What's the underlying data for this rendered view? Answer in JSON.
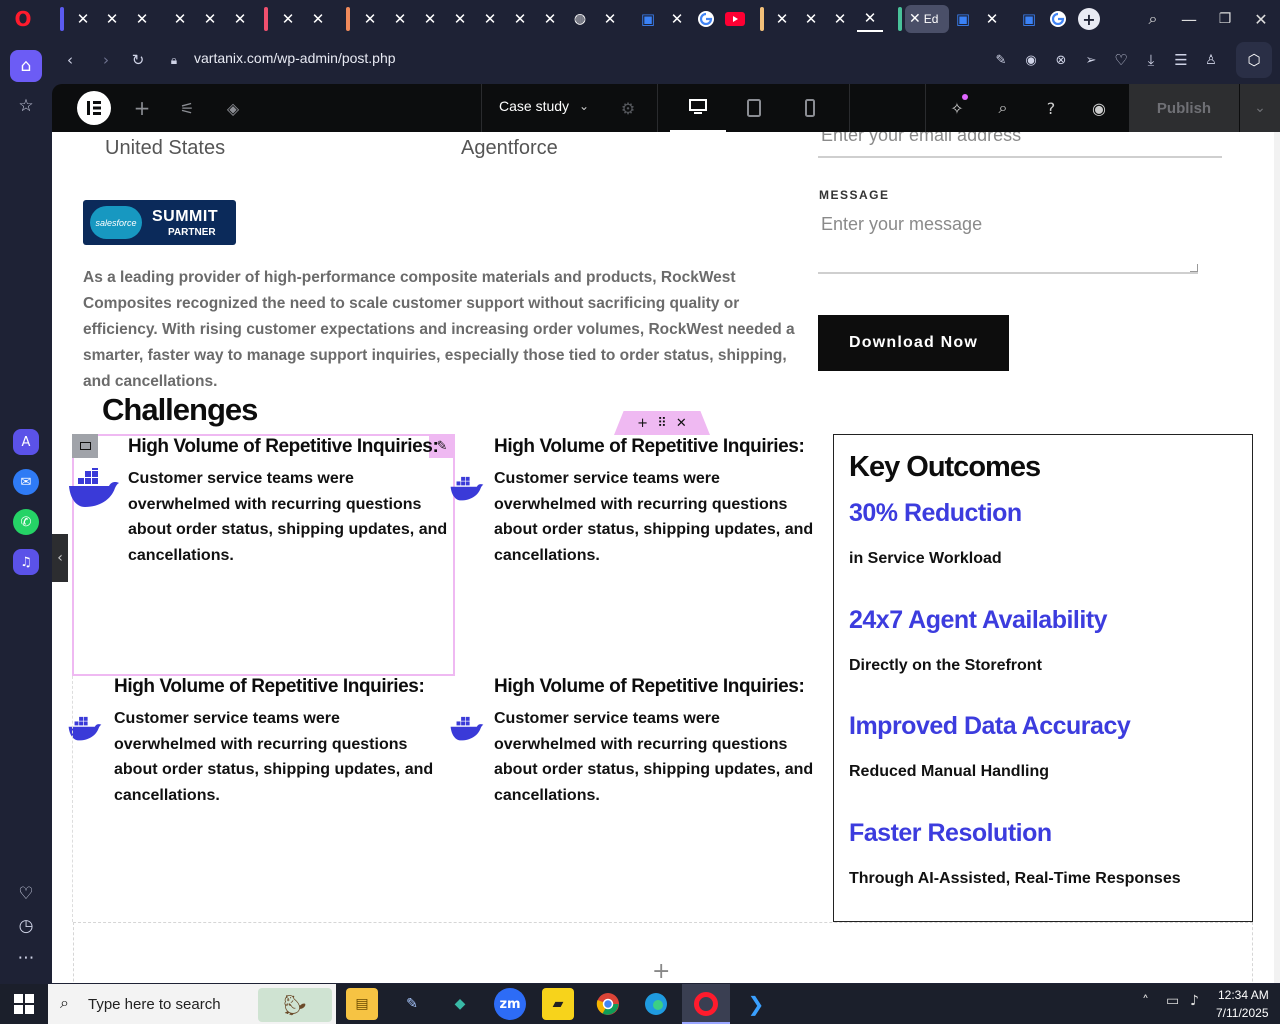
{
  "browser": {
    "url": "vartanix.com/wp-admin/post.php",
    "active_tab_label": "Ed"
  },
  "editor": {
    "page_template": "Case study",
    "publish_label": "Publish"
  },
  "page": {
    "country": "United States",
    "product": "Agentforce",
    "badge": {
      "brand": "salesforce",
      "title": "SUMMIT",
      "subtitle": "PARTNER"
    },
    "intro": "As a leading provider of high-performance composite materials and products, RockWest Composites recognized the need to scale customer support without sacrificing quality or efficiency. With rising customer expectations and increasing order volumes, RockWest needed a smarter, faster way to manage support inquiries, especially those tied to order status, shipping, and cancellations.",
    "form": {
      "email_placeholder": "Enter your email address",
      "message_label": "MESSAGE",
      "message_placeholder": "Enter your message",
      "download_label": "Download Now"
    },
    "challenges_title": "Challenges",
    "challenges": [
      {
        "title": "High Volume of Repetitive Inquiries:",
        "body": "Customer service teams were overwhelmed with recurring questions about order status, shipping updates, and cancellations."
      },
      {
        "title": "High Volume of Repetitive Inquiries:",
        "body": "Customer service teams were overwhelmed with recurring questions about order status, shipping updates, and cancellations."
      },
      {
        "title": "High Volume of Repetitive Inquiries:",
        "body": "Customer service teams were overwhelmed with recurring questions about order status, shipping updates, and cancellations."
      },
      {
        "title": "High Volume of Repetitive Inquiries:",
        "body": "Customer service teams were overwhelmed with recurring questions about order status, shipping updates, and cancellations."
      }
    ],
    "outcomes_title": "Key Outcomes",
    "outcomes": [
      {
        "value": "30% Reduction",
        "desc": "in Service Workload"
      },
      {
        "value": "24x7 Agent Availability",
        "desc": "Directly on the Storefront"
      },
      {
        "value": "Improved Data Accuracy",
        "desc": "Reduced Manual Handling"
      },
      {
        "value": "Faster Resolution",
        "desc": "Through AI-Assisted, Real-Time Responses"
      }
    ]
  },
  "taskbar": {
    "search_placeholder": "Type here to search",
    "time": "12:34 AM",
    "date": "7/11/2025",
    "zoom_label": "zm"
  },
  "colors": {
    "accent_blue": "#3c3cde",
    "docker_blue": "#3a3ad8",
    "elementor_dark": "#0c0d0e",
    "selection_pink": "#e6b8f0",
    "opera_red": "#ff1b2d"
  }
}
